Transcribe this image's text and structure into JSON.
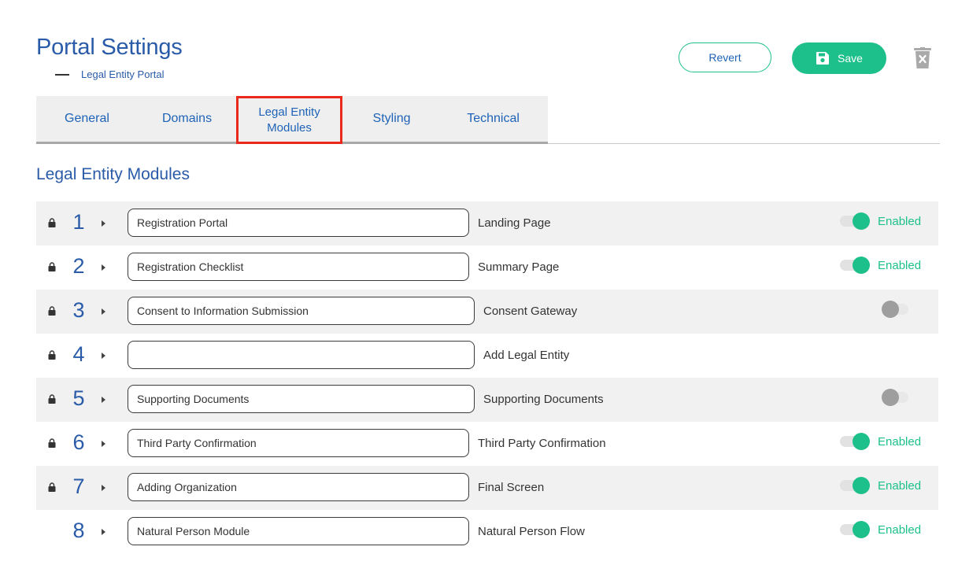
{
  "header": {
    "title": "Portal Settings",
    "subtitle": "Legal Entity Portal",
    "revert_label": "Revert",
    "save_label": "Save"
  },
  "tabs": [
    {
      "label": "General",
      "active": false
    },
    {
      "label": "Domains",
      "active": false
    },
    {
      "label": "Legal Entity Modules",
      "active": true
    },
    {
      "label": "Styling",
      "active": false
    },
    {
      "label": "Technical",
      "active": false
    }
  ],
  "section_title": "Legal Entity Modules",
  "modules": [
    {
      "number": "1",
      "locked": true,
      "name": "Registration Portal",
      "page": "Landing Page",
      "toggle": "on",
      "status": "Enabled"
    },
    {
      "number": "2",
      "locked": true,
      "name": "Registration Checklist",
      "page": "Summary Page",
      "toggle": "on",
      "status": "Enabled"
    },
    {
      "number": "3",
      "locked": true,
      "name": "Consent to Information Submission",
      "page": "Consent Gateway",
      "toggle": "off",
      "status": ""
    },
    {
      "number": "4",
      "locked": true,
      "name": "",
      "page": "Add Legal Entity",
      "toggle": "none",
      "status": ""
    },
    {
      "number": "5",
      "locked": true,
      "name": "Supporting Documents",
      "page": "Supporting Documents",
      "toggle": "off",
      "status": ""
    },
    {
      "number": "6",
      "locked": true,
      "name": "Third Party Confirmation",
      "page": "Third Party Confirmation",
      "toggle": "on",
      "status": "Enabled"
    },
    {
      "number": "7",
      "locked": true,
      "name": "Adding Organization",
      "page": "Final Screen",
      "toggle": "on",
      "status": "Enabled"
    },
    {
      "number": "8",
      "locked": false,
      "name": "Natural Person Module",
      "page": "Natural Person Flow",
      "toggle": "on",
      "status": "Enabled"
    }
  ],
  "colors": {
    "accent_green": "#1dc08a",
    "primary_blue": "#2a5ba8",
    "highlight_red": "#e8291c"
  }
}
